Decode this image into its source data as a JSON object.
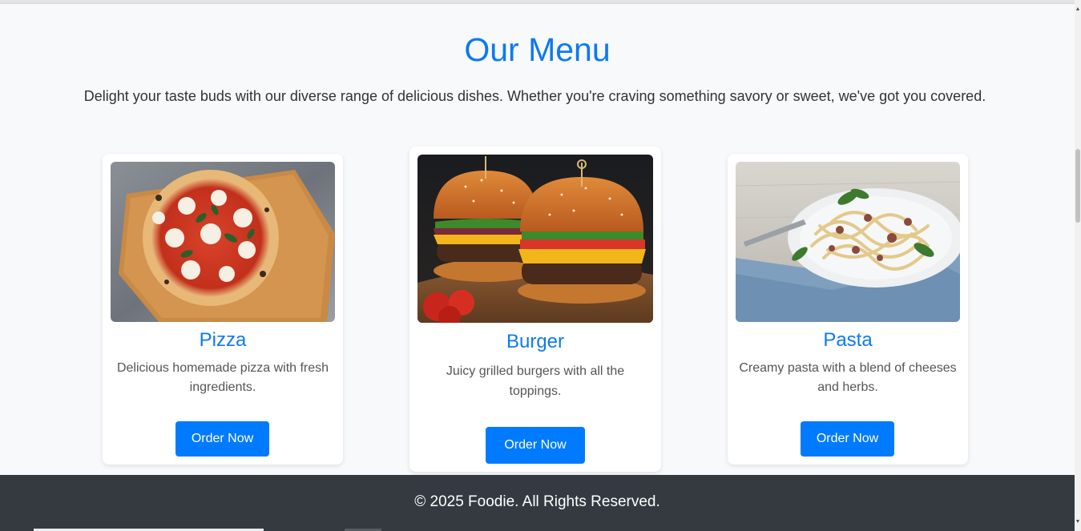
{
  "menu": {
    "title": "Our Menu",
    "intro": "Delight your taste buds with our diverse range of delicious dishes. Whether you're craving something savory or sweet, we've got you covered."
  },
  "items": [
    {
      "name": "Pizza",
      "description": "Delicious homemade pizza with fresh ingredients.",
      "button": "Order Now",
      "image_icon": "pizza-image"
    },
    {
      "name": "Burger",
      "description": "Juicy grilled burgers with all the toppings.",
      "button": "Order Now",
      "image_icon": "burger-image"
    },
    {
      "name": "Pasta",
      "description": "Creamy pasta with a blend of cheeses and herbs.",
      "button": "Order Now",
      "image_icon": "pasta-image"
    }
  ],
  "footer": {
    "text": "© 2025 Foodie. All Rights Reserved."
  },
  "colors": {
    "accent": "#0d79f2",
    "button": "#007bff",
    "footer_bg": "#343a40",
    "page_bg": "#f8f9fa"
  }
}
